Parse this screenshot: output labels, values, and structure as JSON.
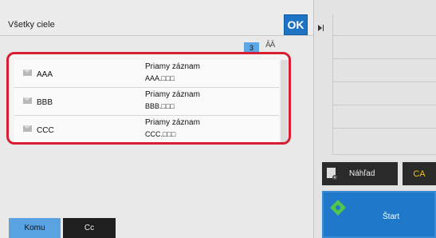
{
  "header": {
    "title": "Všetky ciele",
    "ok_label": "OK"
  },
  "list": {
    "count": "3",
    "sort_icon": "ĀĀ",
    "rows": [
      {
        "name": "AAA",
        "type": "Priamy záznam",
        "sub": "AAA.□□□",
        "icon": "mail-icon"
      },
      {
        "name": "BBB",
        "type": "Priamy záznam",
        "sub": "BBB.□□□",
        "icon": "mail-icon"
      },
      {
        "name": "CCC",
        "type": "Priamy záznam",
        "sub": "CCC.□□□",
        "icon": "mail-icon"
      }
    ]
  },
  "tabs": {
    "komu": "Komu",
    "cc": "Cc"
  },
  "right": {
    "preview_label": "Náhľad",
    "ca_label": "CA",
    "start_label": "Štart"
  },
  "colors": {
    "ok_blue": "#1e73c4",
    "highlight_red": "#d81e32",
    "active_tab": "#5aa3e2",
    "start_blue": "#1f78c9",
    "ca_yellow": "#f2c400"
  }
}
